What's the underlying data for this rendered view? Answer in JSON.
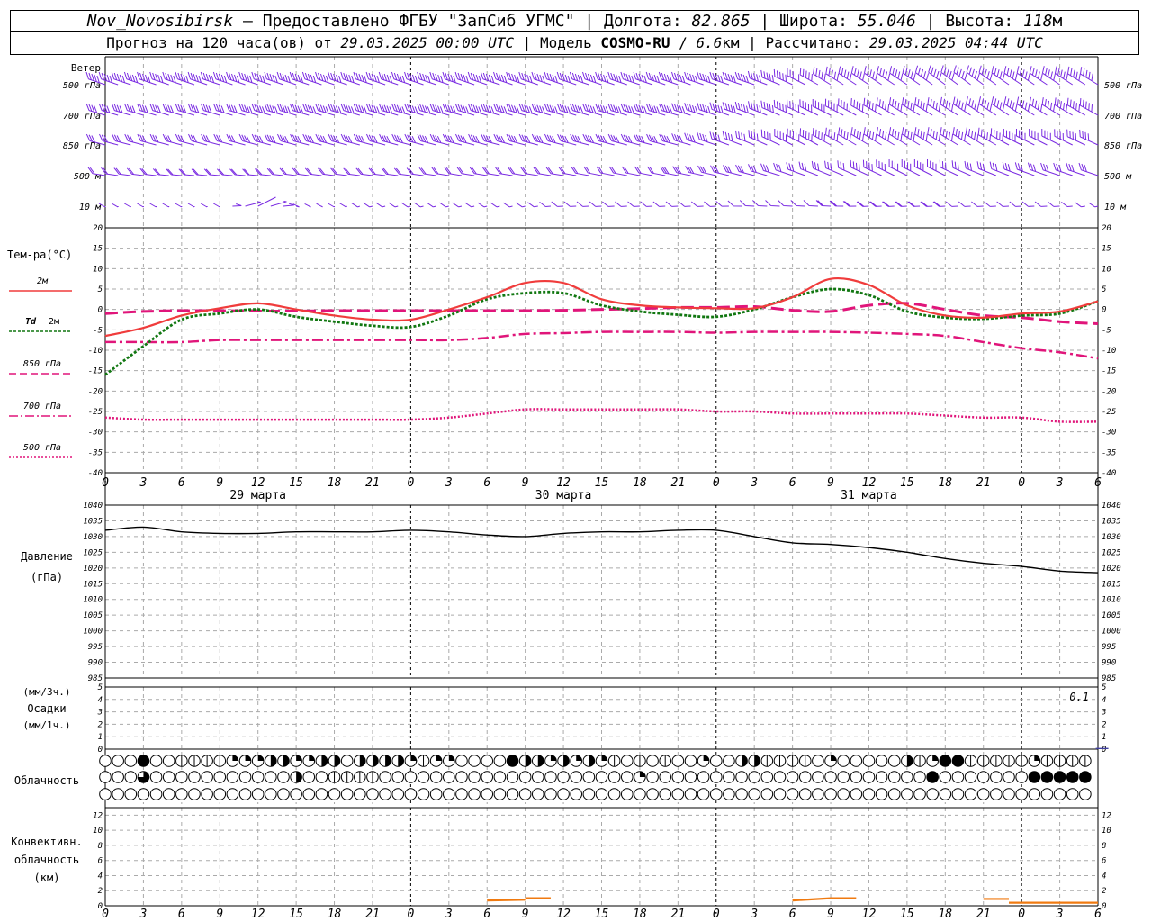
{
  "header": {
    "station": "Nov_Novosibirsk",
    "dash": " – ",
    "provider": "Предоставлено ФГБУ \"ЗапСиб УГМС\"",
    "sep": " | ",
    "lon_label": "Долгота:",
    "lon_value": "82.865",
    "lat_label": "Широта:",
    "lat_value": "55.046",
    "alt_label": "Высота:",
    "alt_value": "118",
    "alt_unit": "м",
    "forecast_prefix": "Прогноз на 120 часа(ов) от",
    "forecast_date": "29.03.2025 00:00 UTC",
    "model_label": "Модель",
    "model_name": "COSMO-RU",
    "model_res": "6.6",
    "model_res_unit": "км",
    "calc_label": "Рассчитано:",
    "calc_date": "29.03.2025 04:44 UTC"
  },
  "colors": {
    "wind": "#7a2be2",
    "t2m": "#f03c3c",
    "td2m": "#117711",
    "t850": "#e0157a",
    "t700": "#e0157a",
    "t500": "#e0157a",
    "pressure": "#000000",
    "conv": "#f07a10",
    "grid": "#aaaaaa"
  },
  "labels": {
    "wind": "Ветер",
    "levels": [
      "500 гПа",
      "700 гПа",
      "850 гПа",
      "500 м",
      "10 м"
    ],
    "temp_title": "Тем-ра(°С)",
    "t2m": "2м",
    "td": "Td",
    "td2m": "2м",
    "t850": "850 гПа",
    "t700": "700 гПа",
    "t500": "500 гПа",
    "pressure_title": "Давление",
    "pressure_unit": "(гПа)",
    "precip_unit3": "(мм/3ч.)",
    "precip_title": "Осадки",
    "precip_unit1": "(мм/1ч.)",
    "precip_value": "0.1",
    "cloud_title": "Облачность",
    "conv_title1": "Конвективн.",
    "conv_title2": "облачность",
    "conv_unit": "(км)",
    "days": [
      "29 марта",
      "30 марта",
      "31 марта"
    ]
  },
  "chart_data": [
    {
      "type": "line",
      "title": "Тем-ра(°С)",
      "x_hours": [
        0,
        3,
        6,
        9,
        12,
        15,
        18,
        21,
        24,
        27,
        30,
        33,
        36,
        39,
        42,
        45,
        48,
        51,
        54,
        57,
        60,
        63,
        66,
        69,
        72,
        75,
        78
      ],
      "ylim": [
        -40,
        20
      ],
      "yticks": [
        20,
        15,
        10,
        5,
        0,
        -5,
        -10,
        -15,
        -20,
        -25,
        -30,
        -35,
        -40
      ],
      "series": [
        {
          "name": "2м",
          "style": "solid",
          "values": [
            -6.5,
            -4.5,
            -1.5,
            0.3,
            1.5,
            0,
            -1.5,
            -2.5,
            -2.5,
            0,
            3,
            6.5,
            6.5,
            2.5,
            1,
            0.5,
            0.3,
            0.3,
            3,
            7.5,
            6,
            1,
            -1.5,
            -2,
            -1,
            -0.5,
            2
          ]
        },
        {
          "name": "Td 2м",
          "style": "dotted",
          "values": [
            -16,
            -9,
            -2.5,
            -1,
            0,
            -1.8,
            -3,
            -4,
            -4.3,
            -1.5,
            2.5,
            4,
            4,
            1,
            -0.5,
            -1.3,
            -1.8,
            0,
            3,
            5,
            3.5,
            -0.5,
            -2,
            -2.3,
            -1.5,
            -1,
            2
          ]
        },
        {
          "name": "850 гПа",
          "style": "dash",
          "values": [
            -1,
            -0.5,
            -0.3,
            -0.3,
            -0.4,
            -0.4,
            -0.3,
            -0.3,
            -0.3,
            -0.3,
            -0.3,
            -0.3,
            -0.2,
            0,
            0.2,
            0.5,
            0.5,
            0.7,
            -0.2,
            -0.5,
            1,
            1.5,
            0,
            -1.5,
            -2,
            -3,
            -3.5
          ]
        },
        {
          "name": "700 гПа",
          "style": "dashdot",
          "values": [
            -8,
            -8,
            -8,
            -7.5,
            -7.5,
            -7.5,
            -7.5,
            -7.5,
            -7.5,
            -7.5,
            -7,
            -6,
            -5.8,
            -5.5,
            -5.5,
            -5.5,
            -5.7,
            -5.5,
            -5.5,
            -5.5,
            -5.7,
            -6,
            -6.5,
            -8,
            -9.5,
            -10.5,
            -12
          ]
        },
        {
          "name": "500 гПа",
          "style": "dense-dot",
          "values": [
            -26.5,
            -27,
            -27,
            -27,
            -27,
            -27,
            -27,
            -27,
            -27,
            -26.5,
            -25.5,
            -24.5,
            -24.5,
            -24.5,
            -24.5,
            -24.5,
            -25,
            -25,
            -25.5,
            -25.5,
            -25.5,
            -25.5,
            -26,
            -26.5,
            -26.5,
            -27.5,
            -27.5
          ]
        }
      ]
    },
    {
      "type": "line",
      "title": "Давление",
      "ylabel": "(гПа)",
      "x_hours": [
        0,
        3,
        6,
        9,
        12,
        15,
        18,
        21,
        24,
        27,
        30,
        33,
        36,
        39,
        42,
        45,
        48,
        51,
        54,
        57,
        60,
        63,
        66,
        69,
        72,
        75,
        78
      ],
      "ylim": [
        985,
        1040
      ],
      "yticks": [
        1040,
        1035,
        1030,
        1025,
        1020,
        1015,
        1010,
        1005,
        1000,
        995,
        990,
        985
      ],
      "series": [
        {
          "name": "Давление",
          "values": [
            1032,
            1033,
            1031.5,
            1031,
            1031,
            1031.5,
            1031.5,
            1031.5,
            1032,
            1031.5,
            1030.5,
            1030,
            1031,
            1031.5,
            1031.5,
            1032,
            1032,
            1030,
            1028,
            1027.5,
            1026.5,
            1025,
            1023,
            1021.5,
            1020.5,
            1019,
            1018.5
          ]
        }
      ]
    },
    {
      "type": "bar",
      "title": "Осадки",
      "ylim": [
        0,
        5
      ],
      "yticks": [
        5,
        4,
        3,
        2,
        1,
        0
      ],
      "max_label": "0.1",
      "values_hours": [
        75
      ],
      "values": [
        0.1
      ]
    },
    {
      "type": "line",
      "title": "Конвективн. облачность",
      "ylabel": "(км)",
      "ylim": [
        0,
        13
      ],
      "yticks": [
        12,
        10,
        8,
        6,
        4,
        2,
        0
      ],
      "segments": [
        {
          "x": [
            30,
            33
          ],
          "y": [
            0.7,
            0.8
          ]
        },
        {
          "x": [
            33,
            35
          ],
          "y": [
            1,
            1
          ]
        },
        {
          "x": [
            54,
            57
          ],
          "y": [
            0.7,
            1
          ]
        },
        {
          "x": [
            57,
            59
          ],
          "y": [
            1,
            1
          ]
        },
        {
          "x": [
            69,
            71
          ],
          "y": [
            0.9,
            0.9
          ]
        },
        {
          "x": [
            71,
            78
          ],
          "y": [
            0.4,
            0.4
          ]
        }
      ]
    },
    {
      "type": "table",
      "title": "Облачность",
      "step_hours": 1,
      "rows": [
        "000800111122233223303333212200008332323210101002003311110200000312881111121111",
        "000400000000000300111100000000000000000000200000000000000000000008000000088888",
        "000000000000000000000000000000000000000000000000000000000000000000000000000000"
      ]
    }
  ],
  "axis": {
    "x_tick_labels": [
      "0",
      "3",
      "6",
      "9",
      "12",
      "15",
      "18",
      "21",
      "0",
      "3",
      "6",
      "9",
      "12",
      "15",
      "18",
      "21",
      "0",
      "3",
      "6",
      "9",
      "12",
      "15",
      "18",
      "21",
      "0",
      "3",
      "6"
    ],
    "temp_ticks": [
      "20",
      "15",
      "10",
      "5",
      "0",
      "-5",
      "-10",
      "-15",
      "-20",
      "-25",
      "-30",
      "-35",
      "-40"
    ],
    "pres_ticks": [
      "1040",
      "1035",
      "1030",
      "1025",
      "1020",
      "1015",
      "1010",
      "1005",
      "1000",
      "995",
      "990",
      "985"
    ],
    "precip_ticks": [
      "5",
      "4",
      "3",
      "2",
      "1",
      "0"
    ],
    "conv_ticks": [
      "12",
      "10",
      "8",
      "6",
      "4",
      "2",
      "0"
    ]
  },
  "wind": {
    "levels": [
      {
        "name": "500 гПа",
        "dir": [
          250,
          250,
          250,
          250,
          250,
          250,
          250,
          250,
          250,
          250,
          250,
          250,
          250,
          250,
          250,
          250,
          250,
          250,
          265,
          280,
          285,
          285,
          290,
          290,
          285,
          285,
          280
        ],
        "speed": [
          50,
          50,
          50,
          50,
          55,
          55,
          55,
          55,
          55,
          55,
          55,
          55,
          55,
          55,
          55,
          55,
          60,
          60,
          65,
          70,
          70,
          70,
          70,
          70,
          65,
          65,
          60
        ]
      },
      {
        "name": "700 гПа",
        "dir": [
          245,
          245,
          245,
          245,
          245,
          245,
          245,
          245,
          245,
          245,
          245,
          245,
          245,
          245,
          245,
          245,
          250,
          255,
          265,
          270,
          275,
          280,
          280,
          285,
          285,
          280,
          275
        ],
        "speed": [
          40,
          40,
          40,
          40,
          45,
          45,
          45,
          45,
          45,
          45,
          45,
          45,
          45,
          45,
          45,
          45,
          50,
          50,
          55,
          60,
          60,
          60,
          60,
          60,
          55,
          55,
          50
        ]
      },
      {
        "name": "850 гПа",
        "dir": [
          240,
          240,
          240,
          240,
          240,
          240,
          240,
          240,
          240,
          240,
          240,
          240,
          240,
          240,
          240,
          240,
          250,
          260,
          270,
          275,
          280,
          280,
          280,
          280,
          270,
          270,
          265
        ],
        "speed": [
          30,
          30,
          30,
          30,
          35,
          35,
          35,
          35,
          35,
          35,
          35,
          35,
          35,
          35,
          35,
          35,
          40,
          40,
          45,
          50,
          50,
          50,
          50,
          45,
          45,
          40,
          40
        ]
      },
      {
        "name": "500 м",
        "dir": [
          225,
          220,
          215,
          215,
          215,
          220,
          220,
          220,
          220,
          225,
          225,
          225,
          225,
          230,
          230,
          230,
          235,
          240,
          250,
          260,
          265,
          270,
          270,
          260,
          255,
          250,
          250
        ],
        "speed": [
          20,
          20,
          15,
          15,
          15,
          20,
          20,
          20,
          20,
          20,
          20,
          20,
          20,
          20,
          20,
          25,
          25,
          25,
          30,
          30,
          35,
          35,
          35,
          30,
          30,
          30,
          25
        ]
      },
      {
        "name": "10 м",
        "dir": [
          180,
          180,
          180,
          180,
          90,
          170,
          180,
          190,
          190,
          190,
          190,
          190,
          200,
          200,
          200,
          200,
          200,
          210,
          210,
          210,
          200,
          200,
          200,
          200,
          200,
          200,
          190
        ],
        "speed": [
          10,
          10,
          10,
          10,
          10,
          10,
          10,
          10,
          10,
          10,
          10,
          10,
          10,
          10,
          10,
          10,
          10,
          10,
          10,
          15,
          15,
          15,
          15,
          10,
          10,
          10,
          10
        ]
      }
    ]
  }
}
